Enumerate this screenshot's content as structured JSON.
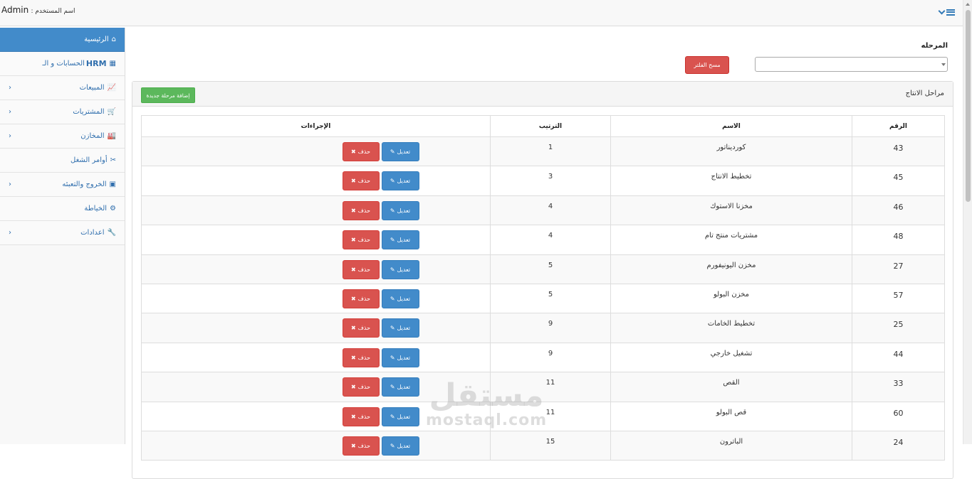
{
  "header": {
    "username_label": "اسم المستخدم :",
    "username": "Admin",
    "toggle_icon": "menu-bars-icon"
  },
  "sidebar": {
    "items": [
      {
        "label": "الرئيسية",
        "icon": "home-icon",
        "glyph": "⌂",
        "active": true,
        "has_submenu": false
      },
      {
        "label": "الحسابات و الـ",
        "extra": "HRM",
        "icon": "calculator-icon",
        "glyph": "▦",
        "active": false,
        "has_submenu": false
      },
      {
        "label": "المبيعات",
        "icon": "chart-icon",
        "glyph": "📈",
        "active": false,
        "has_submenu": true
      },
      {
        "label": "المشتريات",
        "icon": "cart-icon",
        "glyph": "🛒",
        "active": false,
        "has_submenu": true
      },
      {
        "label": "المخازن",
        "icon": "industry-icon",
        "glyph": "🏭",
        "active": false,
        "has_submenu": true
      },
      {
        "label": "أوامر الشغل",
        "icon": "scissors-icon",
        "glyph": "✂",
        "active": false,
        "has_submenu": false
      },
      {
        "label": "الخروج والتعبئه",
        "icon": "archive-icon",
        "glyph": "▣",
        "active": false,
        "has_submenu": true
      },
      {
        "label": "الخياطة",
        "icon": "gear-icon",
        "glyph": "⚙",
        "active": false,
        "has_submenu": false
      },
      {
        "label": "اعدادات",
        "icon": "wrench-icon",
        "glyph": "🔧",
        "active": false,
        "has_submenu": true
      }
    ]
  },
  "filter": {
    "label": "المرحله",
    "select_value": "",
    "clear_label": "مسح الفلتر"
  },
  "panel": {
    "title": "مراحل الانتاج",
    "add_label": "إضافة مرحلة جديدة"
  },
  "table": {
    "headers": {
      "num": "الرقم",
      "name": "الاسم",
      "order": "الترتيب",
      "actions": "الإجراءات"
    },
    "edit_label": "تعديل",
    "delete_label": "حذف",
    "rows": [
      {
        "num": "43",
        "name": "كورديناتور",
        "order": "1"
      },
      {
        "num": "45",
        "name": "تخطيط الانتاج",
        "order": "3"
      },
      {
        "num": "46",
        "name": "مخزنا الاستوك",
        "order": "4"
      },
      {
        "num": "48",
        "name": "مشتريات منتج تام",
        "order": "4"
      },
      {
        "num": "27",
        "name": "مخزن اليونيفورم",
        "order": "5"
      },
      {
        "num": "57",
        "name": "مخزن البولو",
        "order": "5"
      },
      {
        "num": "25",
        "name": "تخطيط الخامات",
        "order": "9"
      },
      {
        "num": "44",
        "name": "تشغيل خارجي",
        "order": "9"
      },
      {
        "num": "33",
        "name": "القص",
        "order": "11"
      },
      {
        "num": "60",
        "name": "قص البولو",
        "order": "11"
      },
      {
        "num": "24",
        "name": "الباترون",
        "order": "15"
      }
    ]
  },
  "watermark": {
    "arabic": "مستقل",
    "latin": "mostaql.com"
  }
}
